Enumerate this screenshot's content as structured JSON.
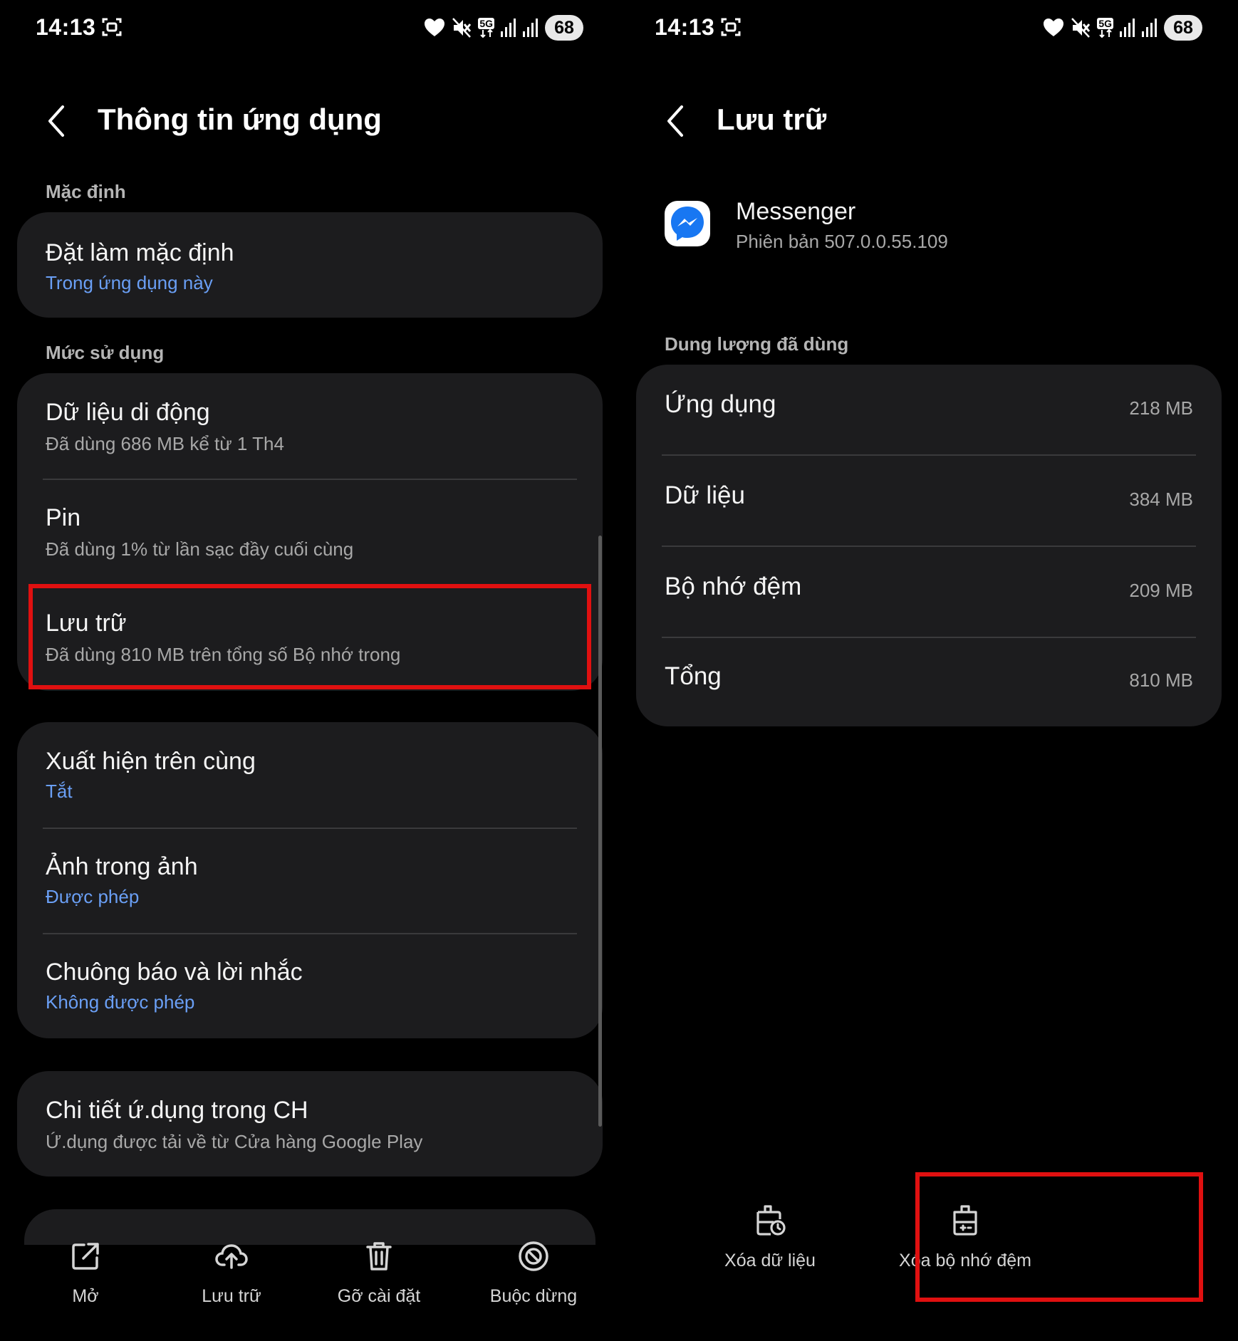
{
  "colors": {
    "background": "#000000",
    "card": "#1c1c1e",
    "accent_blue": "#6a9ff5",
    "highlight_red": "#e01010",
    "divider": "#3a3a3c"
  },
  "left": {
    "status": {
      "time": "14:13",
      "network": "5G",
      "battery": "68",
      "icons": [
        "screenshot-icon",
        "heart-icon",
        "mute-icon",
        "5g-icon",
        "signal-icon",
        "signal-icon",
        "battery-icon"
      ]
    },
    "header": {
      "back_icon": "back-chevron-icon",
      "title": "Thông tin ứng dụng"
    },
    "sections": {
      "default_label": "Mặc định",
      "usage_label": "Mức sử dụng"
    },
    "default_card": {
      "title": "Đặt làm mặc định",
      "subtitle": "Trong ứng dụng này"
    },
    "usage_card": {
      "mobile_data": {
        "title": "Dữ liệu di động",
        "subtitle": "Đã dùng 686 MB kể từ 1 Th4"
      },
      "battery": {
        "title": "Pin",
        "subtitle": "Đã dùng 1% từ lần sạc đầy cuối cùng"
      },
      "storage": {
        "title": "Lưu trữ",
        "subtitle": "Đã dùng 810 MB trên tổng số Bộ nhớ trong"
      }
    },
    "permissions_card": {
      "overlay": {
        "title": "Xuất hiện trên cùng",
        "subtitle": "Tắt"
      },
      "pip": {
        "title": "Ảnh trong ảnh",
        "subtitle": "Được phép"
      },
      "alarms": {
        "title": "Chuông báo và lời nhắc",
        "subtitle": "Không được phép"
      }
    },
    "store_card": {
      "title": "Chi tiết ứ.dụng trong CH",
      "subtitle": "Ứ.dụng được tải về từ Cửa hàng Google Play"
    },
    "bottom_bar": {
      "open": {
        "label": "Mở",
        "icon": "open-external-icon"
      },
      "archive": {
        "label": "Lưu trữ",
        "icon": "cloud-upload-icon"
      },
      "uninstall": {
        "label": "Gỡ cài đặt",
        "icon": "trash-icon"
      },
      "force_stop": {
        "label": "Buộc dừng",
        "icon": "stop-icon"
      }
    }
  },
  "right": {
    "status": {
      "time": "14:13",
      "network": "5G",
      "battery": "68"
    },
    "header": {
      "back_icon": "back-chevron-icon",
      "title": "Lưu trữ"
    },
    "app": {
      "icon": "messenger-icon",
      "name": "Messenger",
      "version": "Phiên bản 507.0.0.55.109"
    },
    "section_label": "Dung lượng đã dùng",
    "storage_rows": [
      {
        "label": "Ứng dụng",
        "value": "218 MB"
      },
      {
        "label": "Dữ liệu",
        "value": "384 MB"
      },
      {
        "label": "Bộ nhớ đệm",
        "value": "209 MB"
      },
      {
        "label": "Tổng",
        "value": "810 MB"
      }
    ],
    "actions": {
      "clear_data": {
        "label": "Xóa dữ liệu",
        "icon": "clear-data-icon"
      },
      "clear_cache": {
        "label": "Xóa bộ nhớ đệm",
        "icon": "clear-cache-icon"
      }
    }
  }
}
